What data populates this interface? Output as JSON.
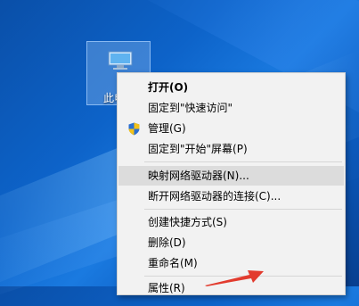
{
  "desktop": {
    "icon_label": "此电脑"
  },
  "context_menu": {
    "items": [
      {
        "label": "打开(O)",
        "bold": true
      },
      {
        "label": "固定到\"快速访问\""
      },
      {
        "label": "管理(G)",
        "icon": "shield-icon"
      },
      {
        "label": "固定到\"开始\"屏幕(P)"
      },
      {
        "label": "映射网络驱动器(N)...",
        "highlighted": true
      },
      {
        "label": "断开网络驱动器的连接(C)..."
      },
      {
        "label": "创建快捷方式(S)"
      },
      {
        "label": "删除(D)"
      },
      {
        "label": "重命名(M)"
      },
      {
        "label": "属性(R)"
      }
    ]
  },
  "colors": {
    "menu_bg": "#f2f2f2",
    "hover_bg": "#dcdcdc",
    "arrow": "#e23b2e"
  }
}
